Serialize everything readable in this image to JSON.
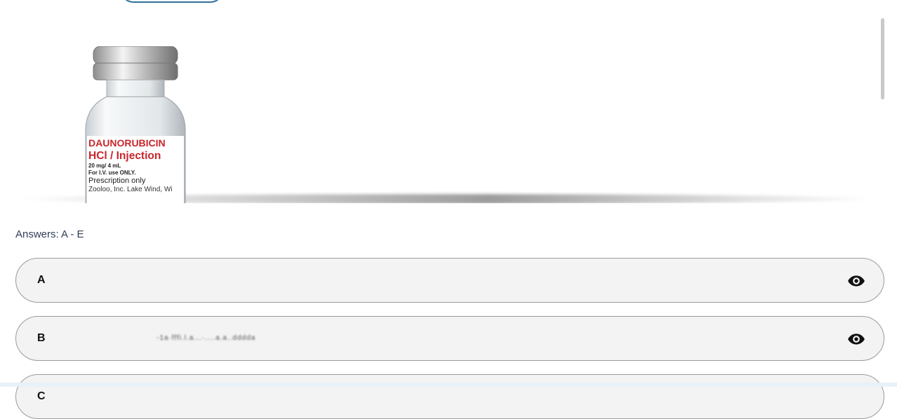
{
  "vial": {
    "drug_name": "DAUNORUBICIN",
    "form": "HCl / Injection",
    "strength": "20 mg/ 4 mL",
    "route": "For I.V. use ONLY.",
    "rx": "Prescription only",
    "manufacturer": "Zooloo, Inc. Lake Wind, Wi"
  },
  "answers": {
    "heading": "Answers: A - E",
    "items": [
      {
        "letter": "A",
        "text": ""
      },
      {
        "letter": "B",
        "text": "-1a·fffi.l.a...·....a.a..dddda"
      },
      {
        "letter": "C",
        "text": ""
      }
    ]
  },
  "icons": {
    "reveal": "eye-icon"
  },
  "colors": {
    "label_red": "#c8262c",
    "heading": "#2f3e56",
    "pill_border": "#9b9b9b"
  }
}
